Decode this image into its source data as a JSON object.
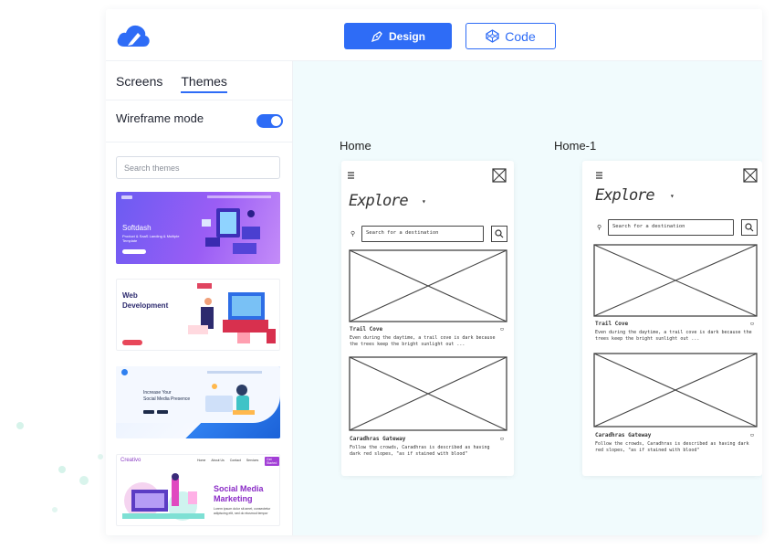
{
  "toolbar": {
    "design_label": "Design",
    "code_label": "Code"
  },
  "sidebar": {
    "tabs": [
      {
        "label": "Screens"
      },
      {
        "label": "Themes"
      }
    ],
    "active_tab": "Themes",
    "wireframe_label": "Wireframe mode",
    "wireframe_on": true,
    "search_placeholder": "Search themes"
  },
  "themes": [
    {
      "title": "Softdash",
      "subtitle": "Product & SaaS Landing & Multiple Template"
    },
    {
      "title_line1": "Web",
      "title_line2": "Development"
    },
    {
      "title_line1": "Increase Your",
      "title_line2": "Social Media Presence"
    },
    {
      "brand": "Creativo",
      "nav": [
        "Home",
        "About Us",
        "Contact",
        "Services"
      ],
      "cta": "Get Started",
      "title_line1": "Social Media",
      "title_line2": "Marketing",
      "text": "Lorem ipsum dolor sit amet, consectetur adipiscing elit, sed do eiusmod tempor"
    }
  ],
  "screens": [
    {
      "label": "Home",
      "heading": "Explore",
      "search_placeholder": "Search for a destination",
      "card1_title": "Trail Cove",
      "card1_text": "Even during the daytime, a trail cove is dark because the trees keep the bright sunlight out ...",
      "card2_title": "Caradhras Gateway",
      "card2_text": "Follow the crowds, Caradhras is described as having dark red slopes, \"as if stained with blood\""
    },
    {
      "label": "Home-1",
      "heading": "Explore",
      "search_placeholder": "Search for a destination",
      "card1_title": "Trail Cove",
      "card1_text": "Even during the daytime, a trail cove is dark because the trees keep the bright sunlight out ...",
      "card2_title": "Caradhras Gateway",
      "card2_text": "Follow the crowds, Caradhras is described as having dark red slopes, \"as if stained with blood\""
    }
  ],
  "colors": {
    "accent": "#2e6cf6",
    "canvas_bg": "#f1fbfd"
  }
}
